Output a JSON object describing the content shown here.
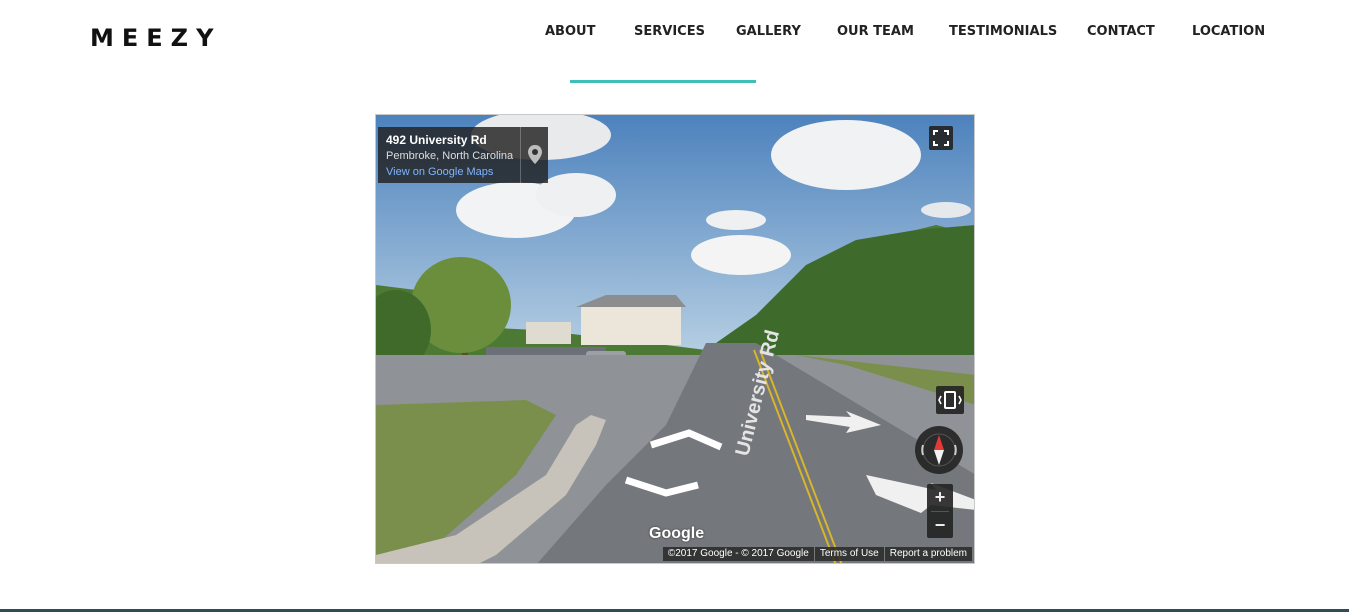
{
  "brand": {
    "logo": "MEEZY"
  },
  "nav": {
    "items": [
      "ABOUT",
      "SERVICES",
      "GALLERY",
      "OUR TEAM",
      "TESTIMONIALS",
      "CONTACT",
      "LOCATION"
    ],
    "active": "SERVICES",
    "accent_color": "#3fbfb8"
  },
  "street_view": {
    "address_title": "492 University Rd",
    "address_sub": "Pembroke, North Carolina",
    "maps_link": "View on Google Maps",
    "road_label": "University Rd",
    "logo": "Google",
    "copyright": "©2017 Google - © 2017 Google",
    "terms": "Terms of Use",
    "report": "Report a problem",
    "zoom_in": "+",
    "zoom_out": "−",
    "icons": [
      "pin-icon",
      "fullscreen-icon",
      "rotate-device-icon",
      "compass-icon",
      "zoom-in-icon",
      "zoom-out-icon"
    ]
  },
  "colors": {
    "footer_bar": "#2d4d58"
  }
}
